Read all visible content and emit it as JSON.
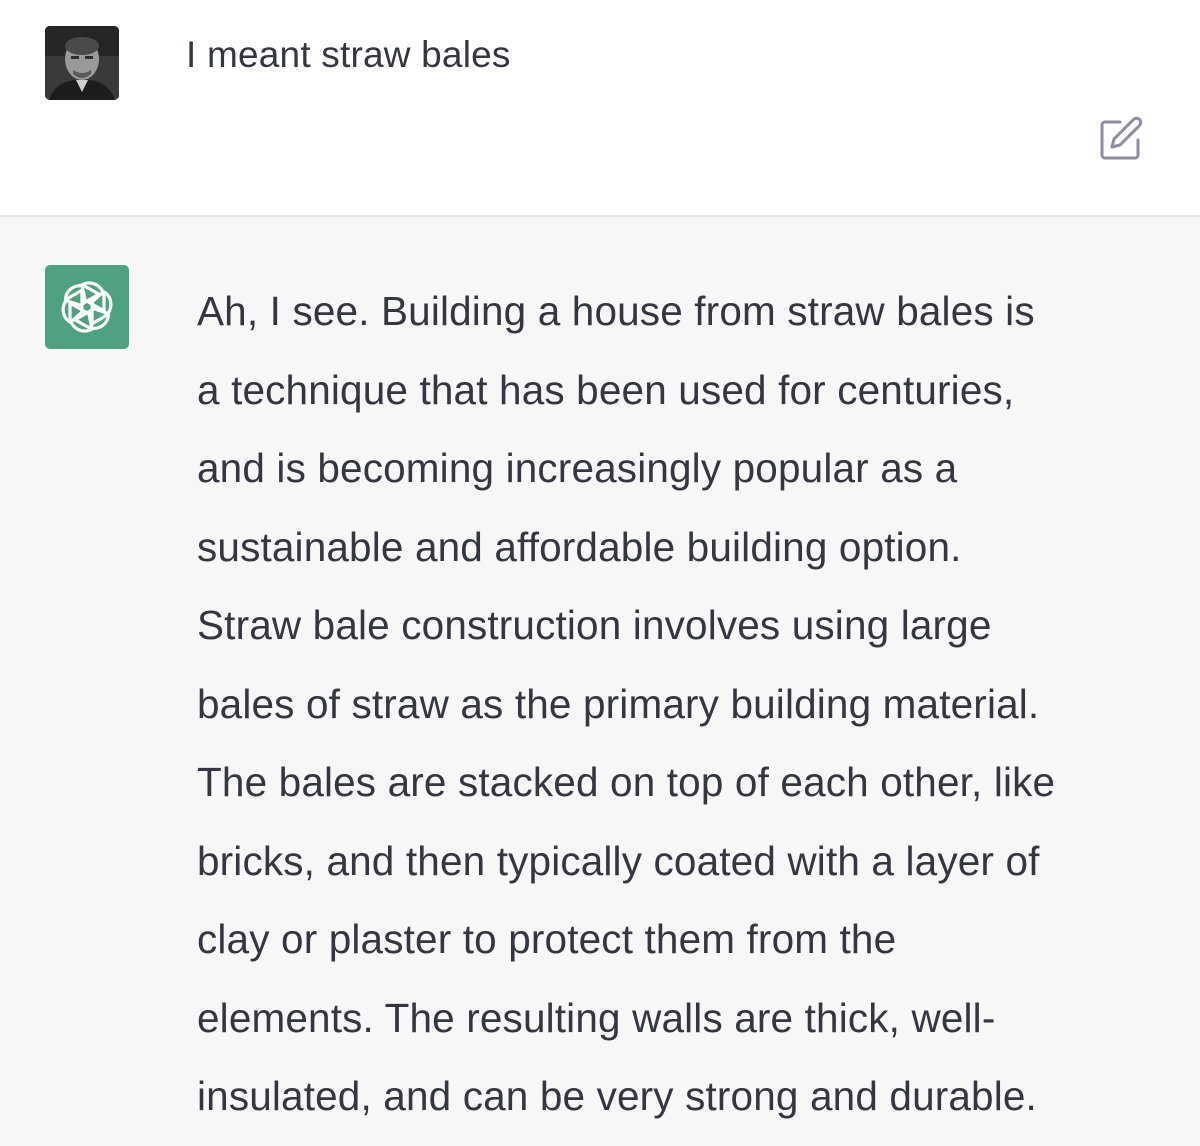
{
  "user_message": {
    "text": "I meant straw bales",
    "avatar_icon": "user-photo-avatar",
    "edit_icon": "edit-icon"
  },
  "assistant_message": {
    "avatar_icon": "openai-logo-icon",
    "avatar_color": "#4fa27f",
    "lines": [
      "Ah, I see. Building a house from straw bales is",
      "a technique that has been used for centuries,",
      "and is becoming increasingly popular as a",
      "sustainable and affordable building option.",
      "Straw bale construction involves using large",
      "bales of straw as the primary building material.",
      "The bales are stacked on top of each other, like",
      "bricks, and then typically coated with a layer of",
      "clay or plaster to protect them from the",
      "elements. The resulting walls are thick, well-",
      "insulated, and can be very strong and durable."
    ]
  }
}
